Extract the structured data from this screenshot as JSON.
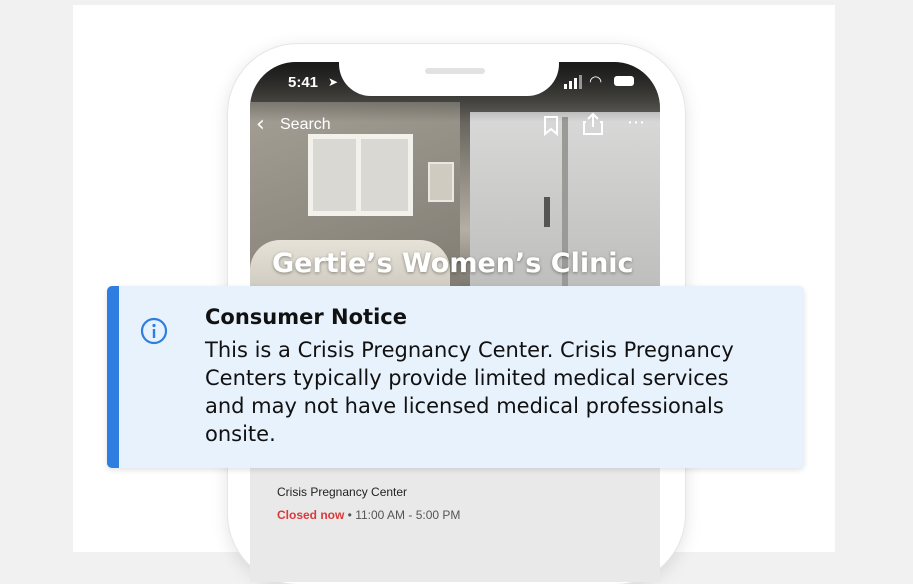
{
  "status_bar": {
    "time": "5:41"
  },
  "nav": {
    "back_label": "Search"
  },
  "place": {
    "name": "Gertie’s Women’s Clinic",
    "category": "Crisis Pregnancy Center",
    "status": "Closed now",
    "separator": " • ",
    "hours": "11:00 AM - 5:00 PM"
  },
  "notice": {
    "title": "Consumer Notice",
    "body": "This is a Crisis Pregnancy Center. Crisis Pregnancy Centers typically provide limited medical services and may not have licensed medical professionals onsite."
  },
  "colors": {
    "accent": "#2e7de0",
    "notice_bg": "#e8f2fc",
    "closed": "#d93a3a"
  },
  "icons": [
    "location-arrow-icon",
    "signal-icon",
    "wifi-icon",
    "battery-icon",
    "back-chevron-icon",
    "bookmark-icon",
    "share-icon",
    "more-icon",
    "info-icon"
  ]
}
